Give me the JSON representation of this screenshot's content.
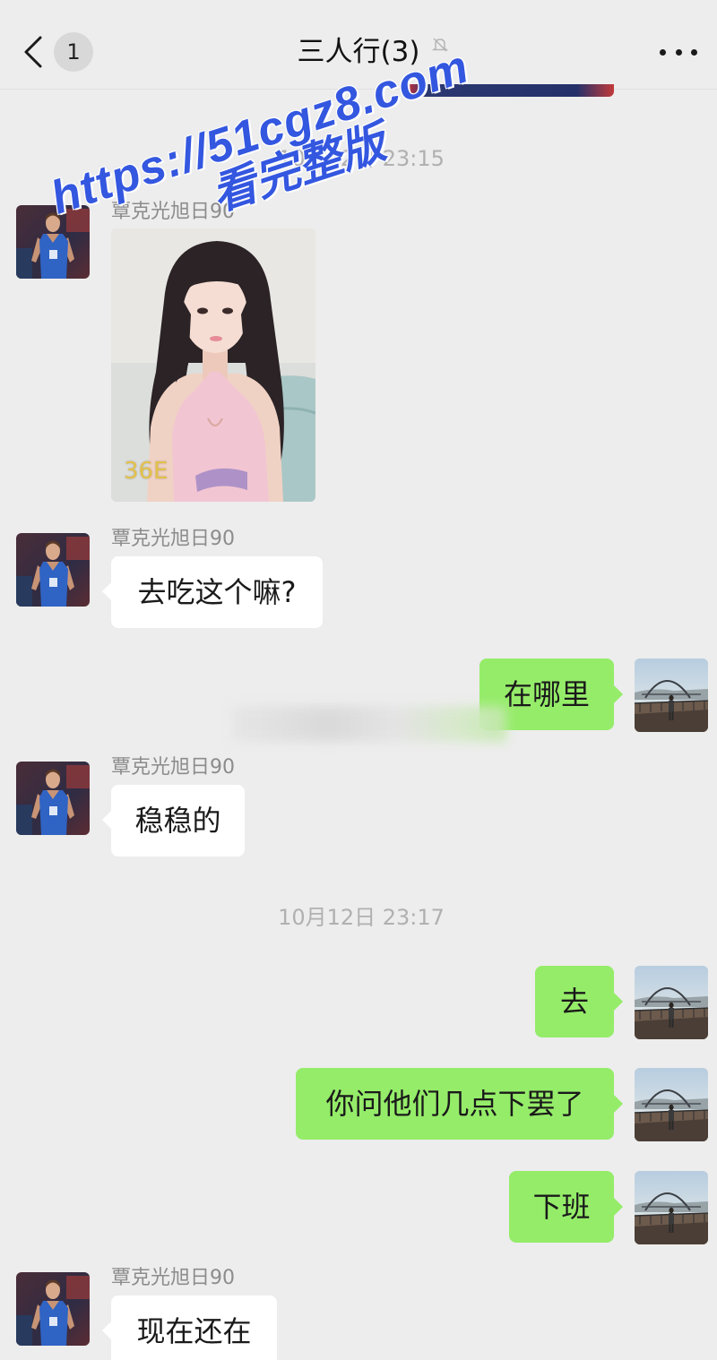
{
  "header": {
    "badge": "1",
    "title": "三人行(3)",
    "icons": {
      "back": "chevron-left-icon",
      "mute": "bell-off-icon",
      "more": "more-icon"
    }
  },
  "watermark": {
    "url": "https://51cgz8.com",
    "caption": "看完整版"
  },
  "timestamps": [
    "10月12日 23:15",
    "10月12日 23:17"
  ],
  "messages": [
    {
      "sender": "覃克光旭日90",
      "image_caption": "36E"
    },
    {
      "sender": "覃克光旭日90",
      "text": "去吃这个嘛?"
    },
    {
      "text": "在哪里"
    },
    {
      "sender": "覃克光旭日90",
      "text": "稳稳的"
    },
    {
      "text": "去"
    },
    {
      "text": "你问他们几点下罢了"
    },
    {
      "text": "下班"
    },
    {
      "sender": "覃克光旭日90",
      "text": "现在还在"
    }
  ],
  "colors": {
    "background": "#ededed",
    "bubble_self": "#95ec69",
    "bubble_other": "#ffffff",
    "watermark": "#3457e0"
  }
}
